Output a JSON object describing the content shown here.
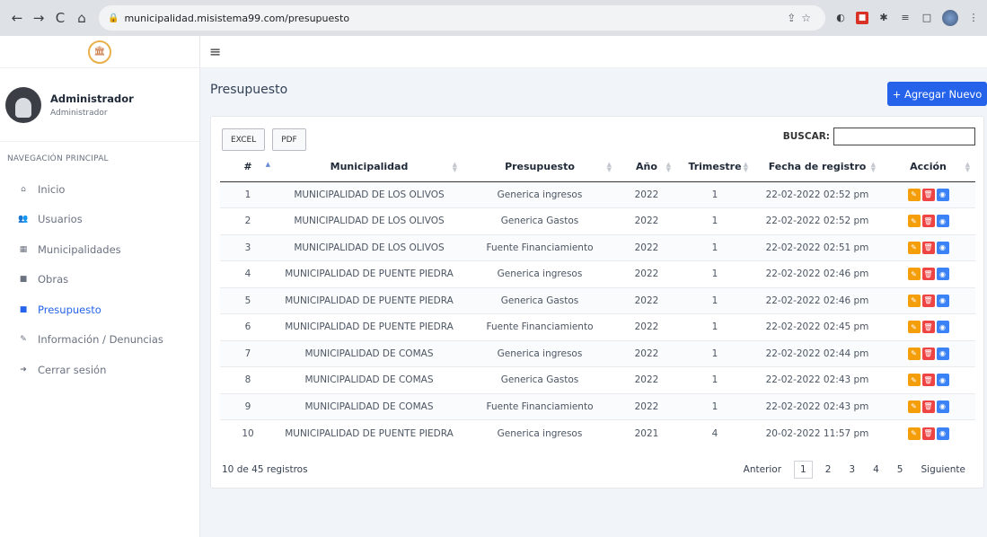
{
  "browser": {
    "url": "municipalidad.misistema99.com/presupuesto",
    "back_icon": "←",
    "forward_icon": "→",
    "reload_icon": "C",
    "home_icon": "⌂"
  },
  "sidebar": {
    "logo_text": "🏛",
    "user_name": "Administrador",
    "user_role": "Administrador",
    "nav_title": "NAVEGACIÓN PRINCIPAL",
    "items": [
      {
        "icon": "⌂",
        "label": "Inicio"
      },
      {
        "icon": "👥",
        "label": "Usuarios"
      },
      {
        "icon": "▦",
        "label": "Municipalidades"
      },
      {
        "icon": "■",
        "label": "Obras"
      },
      {
        "icon": "■",
        "label": "Presupuesto"
      },
      {
        "icon": "✎",
        "label": "Información / Denuncias"
      },
      {
        "icon": "➜",
        "label": "Cerrar sesión"
      }
    ]
  },
  "topbar": {
    "menu_icon": "≡"
  },
  "page": {
    "title": "Presupuesto",
    "add_button": "+ Agregar Nuevo",
    "excel": "EXCEL",
    "pdf": "PDF",
    "search_label": "BUSCAR:"
  },
  "table": {
    "headers": [
      "#",
      "Municipalidad",
      "Presupuesto",
      "Año",
      "Trimestre",
      "Fecha de registro",
      "Acción"
    ],
    "rows": [
      [
        "1",
        "MUNICIPALIDAD DE LOS OLIVOS",
        "Generica ingresos",
        "2022",
        "1",
        "22-02-2022 02:52 pm"
      ],
      [
        "2",
        "MUNICIPALIDAD DE LOS OLIVOS",
        "Generica Gastos",
        "2022",
        "1",
        "22-02-2022 02:52 pm"
      ],
      [
        "3",
        "MUNICIPALIDAD DE LOS OLIVOS",
        "Fuente Financiamiento",
        "2022",
        "1",
        "22-02-2022 02:51 pm"
      ],
      [
        "4",
        "MUNICIPALIDAD DE PUENTE PIEDRA",
        "Generica ingresos",
        "2022",
        "1",
        "22-02-2022 02:46 pm"
      ],
      [
        "5",
        "MUNICIPALIDAD DE PUENTE PIEDRA",
        "Generica Gastos",
        "2022",
        "1",
        "22-02-2022 02:46 pm"
      ],
      [
        "6",
        "MUNICIPALIDAD DE PUENTE PIEDRA",
        "Fuente Financiamiento",
        "2022",
        "1",
        "22-02-2022 02:45 pm"
      ],
      [
        "7",
        "MUNICIPALIDAD DE COMAS",
        "Generica ingresos",
        "2022",
        "1",
        "22-02-2022 02:44 pm"
      ],
      [
        "8",
        "MUNICIPALIDAD DE COMAS",
        "Generica Gastos",
        "2022",
        "1",
        "22-02-2022 02:43 pm"
      ],
      [
        "9",
        "MUNICIPALIDAD DE COMAS",
        "Fuente Financiamiento",
        "2022",
        "1",
        "22-02-2022 02:43 pm"
      ],
      [
        "10",
        "MUNICIPALIDAD DE PUENTE PIEDRA",
        "Generica ingresos",
        "2021",
        "4",
        "20-02-2022 11:57 pm"
      ]
    ]
  },
  "footer": {
    "info": "10 de 45 registros",
    "prev": "Anterior",
    "pages": [
      "1",
      "2",
      "3",
      "4",
      "5"
    ],
    "next": "Siguiente"
  },
  "colors": {
    "accent": "#2563eb",
    "edit": "#f59e0b",
    "delete": "#ef4444",
    "view": "#3b82f6"
  }
}
